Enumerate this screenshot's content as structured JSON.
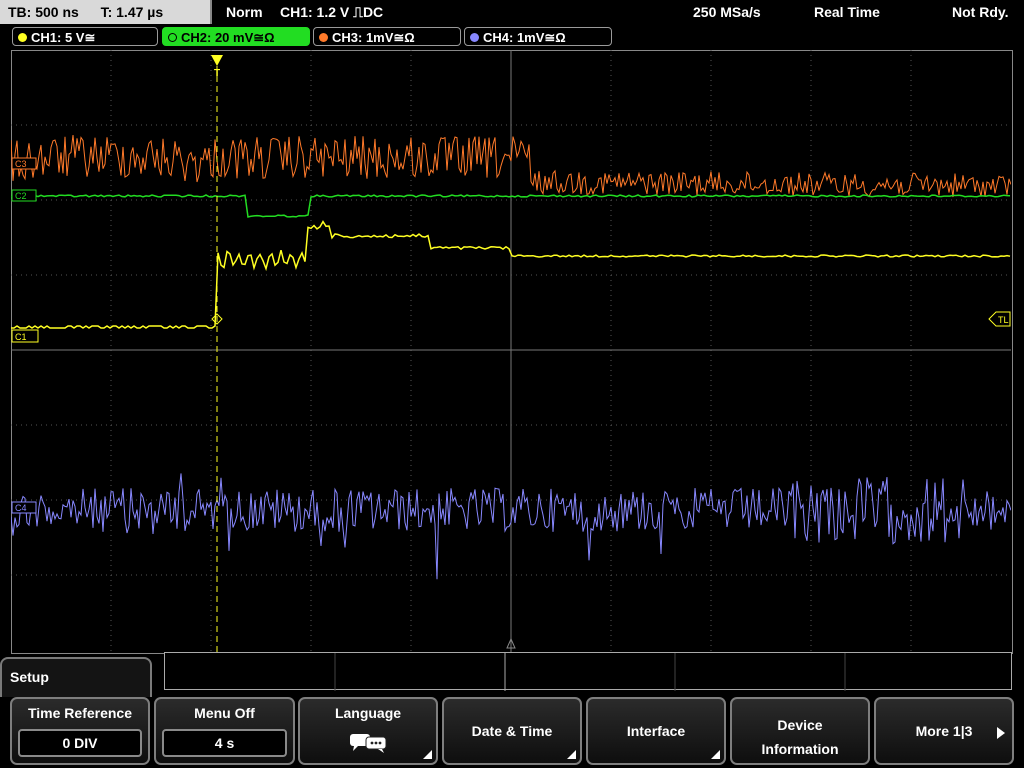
{
  "status": {
    "timebase": "TB: 500 ns",
    "trig_time": "T: 1.47 µs",
    "mode": "Norm",
    "trigger": "CH1: 1.2 V ⎍DC",
    "sample_rate": "250 MSa/s",
    "acq_mode": "Real Time",
    "state": "Not Rdy."
  },
  "channels": [
    {
      "label": "CH1: 5 V≅",
      "color": "#ffff22"
    },
    {
      "label": "CH2: 20 mV≅Ω",
      "color": "#22dd22"
    },
    {
      "label": "CH3: 1mV≅Ω",
      "color": "#ff7a2a"
    },
    {
      "label": "CH4: 1mV≅Ω",
      "color": "#8888ff"
    }
  ],
  "markers": {
    "c3": "C3",
    "c2": "C2",
    "c1": "C1",
    "c4": "C4",
    "trig_level": "TL",
    "trig_pos": "T"
  },
  "menu": {
    "title": "Setup",
    "softkeys": [
      {
        "label": "Time Reference",
        "value": "0 DIV"
      },
      {
        "label": "Menu Off",
        "value": "4 s"
      },
      {
        "label": "Language",
        "icon": "speech-bubbles-icon"
      },
      {
        "label": "Date & Time"
      },
      {
        "label": "Interface"
      },
      {
        "label_line1": "Device",
        "label_line2": "Information"
      },
      {
        "label": "More 1|3"
      }
    ]
  }
}
